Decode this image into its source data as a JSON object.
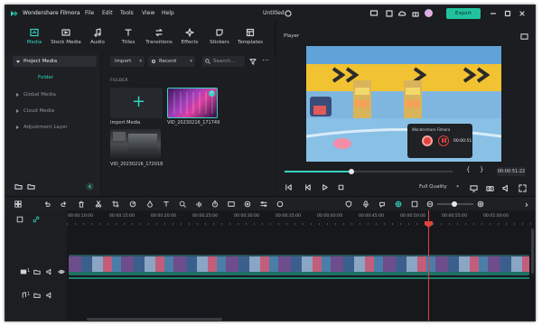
{
  "app": {
    "name": "Wondershare Filmora",
    "project_title": "Untitled"
  },
  "menu": [
    "File",
    "Edit",
    "Tools",
    "View",
    "Help"
  ],
  "export_label": "Export",
  "tabs": [
    {
      "label": "Media",
      "icon": "media-icon",
      "active": true
    },
    {
      "label": "Stock Media",
      "icon": "stock-media-icon"
    },
    {
      "label": "Audio",
      "icon": "audio-icon"
    },
    {
      "label": "Titles",
      "icon": "titles-icon"
    },
    {
      "label": "Transitions",
      "icon": "transitions-icon"
    },
    {
      "label": "Effects",
      "icon": "effects-icon"
    },
    {
      "label": "Stickers",
      "icon": "stickers-icon"
    },
    {
      "label": "Templates",
      "icon": "templates-icon"
    }
  ],
  "sidebar": {
    "items": [
      "Project Media",
      "Global Media",
      "Cloud Media",
      "Adjustment Layer"
    ],
    "folder": "Folder"
  },
  "media": {
    "import_dropdown": "Import",
    "record_dropdown": "Record",
    "search_placeholder": "Search...",
    "folder_label": "FOLDER",
    "import_label": "Import Media",
    "clips": [
      "VID_20230216_171749",
      "VID_20230216_172018"
    ]
  },
  "player": {
    "title": "Player",
    "current_time": "00:00:51:22",
    "quality": "Full Quality",
    "overlay_title": "Wondershare Filmora",
    "overlay_time": "00:00:51",
    "progress": 0.4
  },
  "timeline": {
    "ticks": [
      "00:00:10:00",
      "00:00:15:00",
      "00:00:20:00",
      "00:00:25:00",
      "00:00:30:00",
      "00:00:35:00",
      "00:00:40:00",
      "00:00:45:00",
      "00:00:50:00",
      "00:00:55:00",
      "00:01:00:00"
    ],
    "track_video": "1",
    "track_audio": "1"
  },
  "colors": {
    "accent": "#21c39e",
    "playhead": "#e0443e",
    "background": "#17191c"
  }
}
